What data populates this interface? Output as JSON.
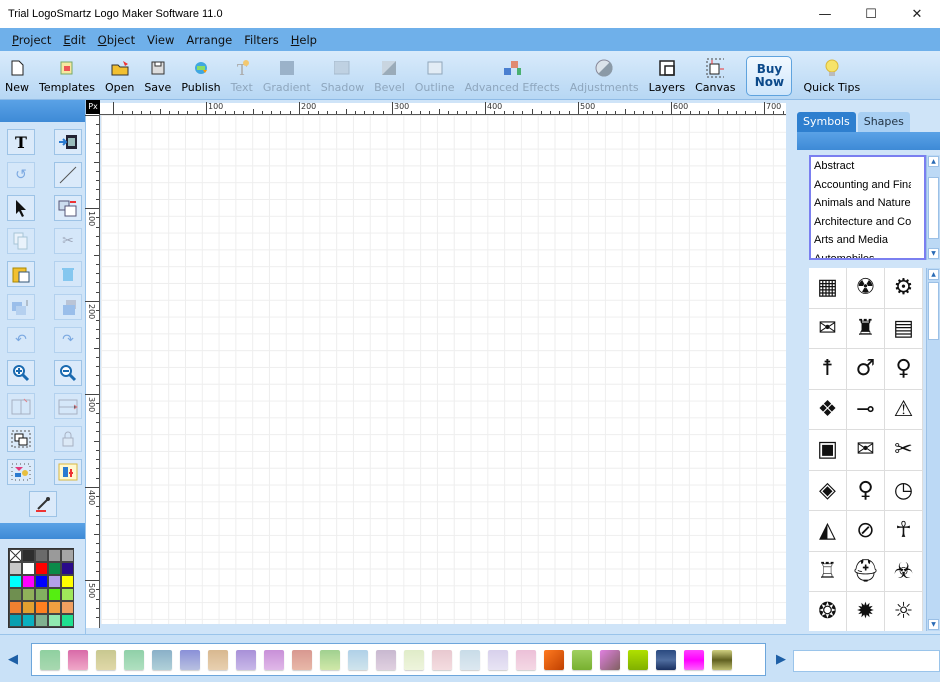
{
  "window": {
    "title": "Trial LogoSmartz Logo Maker Software 11.0",
    "minimize_glyph": "—",
    "maximize_glyph": "☐",
    "close_glyph": "✕"
  },
  "menu": [
    {
      "label": "Project",
      "underline": "P",
      "rest": "roject"
    },
    {
      "label": "Edit",
      "underline": "E",
      "rest": "dit"
    },
    {
      "label": "Object",
      "underline": "O",
      "rest": "bject"
    },
    {
      "label": "View",
      "underline": "",
      "rest": "View"
    },
    {
      "label": "Arrange",
      "underline": "",
      "rest": "Arrange"
    },
    {
      "label": "Filters",
      "underline": "",
      "rest": "Filters"
    },
    {
      "label": "Help",
      "underline": "H",
      "rest": "elp"
    }
  ],
  "toolbar": {
    "items": [
      {
        "label": "New",
        "icon": "new-icon",
        "enabled": true
      },
      {
        "label": "Templates",
        "icon": "templates-icon",
        "enabled": true
      },
      {
        "label": "Open",
        "icon": "open-icon",
        "enabled": true
      },
      {
        "label": "Save",
        "icon": "save-icon",
        "enabled": true
      },
      {
        "label": "Publish",
        "icon": "publish-icon",
        "enabled": true
      },
      {
        "label": "Text",
        "icon": "text-icon",
        "enabled": false
      },
      {
        "label": "Gradient",
        "icon": "gradient-icon",
        "enabled": false
      },
      {
        "label": "Shadow",
        "icon": "shadow-icon",
        "enabled": false
      },
      {
        "label": "Bevel",
        "icon": "bevel-icon",
        "enabled": false
      },
      {
        "label": "Outline",
        "icon": "outline-icon",
        "enabled": false
      },
      {
        "label": "Advanced Effects",
        "icon": "advanced-effects-icon",
        "enabled": false
      },
      {
        "label": "Adjustments",
        "icon": "adjustments-icon",
        "enabled": false
      },
      {
        "label": "Layers",
        "icon": "layers-icon",
        "enabled": true
      },
      {
        "label": "Canvas",
        "icon": "canvas-icon",
        "enabled": true
      }
    ],
    "buy_now": "Buy Now",
    "quick_tips": "Quick Tips"
  },
  "left_tools": [
    {
      "name": "text-tool",
      "enabled": true
    },
    {
      "name": "import-image-tool",
      "enabled": true
    },
    {
      "name": "rotate-tool",
      "enabled": false
    },
    {
      "name": "line-tool",
      "enabled": true
    },
    {
      "name": "select-tool",
      "enabled": true
    },
    {
      "name": "duplicate-tool",
      "enabled": true
    },
    {
      "name": "copy-tool",
      "enabled": false
    },
    {
      "name": "cut-tool",
      "enabled": false
    },
    {
      "name": "paste-tool",
      "enabled": true
    },
    {
      "name": "delete-tool",
      "enabled": false
    },
    {
      "name": "bring-forward-tool",
      "enabled": false
    },
    {
      "name": "send-backward-tool",
      "enabled": false
    },
    {
      "name": "undo-tool",
      "enabled": false
    },
    {
      "name": "redo-tool",
      "enabled": false
    },
    {
      "name": "zoom-in-tool",
      "enabled": true
    },
    {
      "name": "zoom-out-tool",
      "enabled": true
    },
    {
      "name": "flip-horizontal-tool",
      "enabled": false
    },
    {
      "name": "flip-vertical-tool",
      "enabled": false
    },
    {
      "name": "group-tool",
      "enabled": true
    },
    {
      "name": "lock-tool",
      "enabled": false
    },
    {
      "name": "align-tool",
      "enabled": true
    },
    {
      "name": "arrange-tool",
      "enabled": true
    }
  ],
  "palette_colors": [
    "none",
    "#2e2e2e",
    "#6a6a6a",
    "#9a9a9a",
    "#a6a6a6",
    "#c8c8c8",
    "#ffffff",
    "#ff0000",
    "#0b8a4a",
    "#2a0a8a",
    "#00ffff",
    "#ff00ff",
    "#0000ff",
    "#b4a0ea",
    "#ffff00",
    "#6f8f50",
    "#8fb05a",
    "#82b060",
    "#55ee11",
    "#9fe85a",
    "#f08030",
    "#e2a030",
    "#ff8020",
    "#f0a040",
    "#f0a060",
    "#0aa0b0",
    "#0ab0c0",
    "#80b090",
    "#90e8b0",
    "#20e090"
  ],
  "ruler": {
    "unit": "Px",
    "top_labels": [
      "100",
      "200",
      "300",
      "400",
      "500",
      "600",
      "700"
    ],
    "left_labels": [
      "100",
      "200",
      "300",
      "400",
      "500"
    ]
  },
  "right_panel": {
    "tabs": [
      {
        "label": "Symbols",
        "active": true
      },
      {
        "label": "Shapes",
        "active": false
      }
    ],
    "categories": [
      "Abstract",
      "Accounting and Finance",
      "Animals and Nature",
      "Architecture and Construction",
      "Arts and Media",
      "Automobiles"
    ],
    "symbols": [
      {
        "name": "checker-symbol",
        "glyph": "▦"
      },
      {
        "name": "radiation-symbol",
        "glyph": "☢"
      },
      {
        "name": "gear-symbol",
        "glyph": "⚙"
      },
      {
        "name": "money-symbol",
        "glyph": "✉"
      },
      {
        "name": "factory-symbol",
        "glyph": "♜"
      },
      {
        "name": "jar-symbol",
        "glyph": "▤"
      },
      {
        "name": "vitruvian-man-symbol",
        "glyph": "☨"
      },
      {
        "name": "male-symbol",
        "glyph": "♂"
      },
      {
        "name": "female-symbol",
        "glyph": "♀"
      },
      {
        "name": "cash-symbol",
        "glyph": "❖"
      },
      {
        "name": "fuse-symbol",
        "glyph": "⊸"
      },
      {
        "name": "warning-sign-symbol",
        "glyph": "⚠"
      },
      {
        "name": "framed-picture-symbol",
        "glyph": "▣"
      },
      {
        "name": "post-horn-mail-symbol",
        "glyph": "✉"
      },
      {
        "name": "comb-scissors-symbol",
        "glyph": "✂"
      },
      {
        "name": "tickets-symbol",
        "glyph": "◈"
      },
      {
        "name": "woman-symbol",
        "glyph": "♀"
      },
      {
        "name": "clock-symbol",
        "glyph": "◷"
      },
      {
        "name": "landscape-picture-symbol",
        "glyph": "◭"
      },
      {
        "name": "no-city-symbol",
        "glyph": "⊘"
      },
      {
        "name": "person-symbol",
        "glyph": "☥"
      },
      {
        "name": "desk-symbol",
        "glyph": "♖"
      },
      {
        "name": "helmet-symbol",
        "glyph": "⛑"
      },
      {
        "name": "biohazard-symbol",
        "glyph": "☣"
      },
      {
        "name": "dotted-circle-symbol",
        "glyph": "❂"
      },
      {
        "name": "sunburst-symbol",
        "glyph": "✹"
      },
      {
        "name": "sun-outline-symbol",
        "glyph": "☼"
      }
    ]
  },
  "swatches": [
    "linear-gradient(#8fd0a0,#a8d8b0)",
    "linear-gradient(#d86aa8,#f0a8c8)",
    "linear-gradient(#c8c890,#e0d8a8)",
    "linear-gradient(#90d0a8,#b0e0c0)",
    "linear-gradient(#8ab0c8,#b0d0d8)",
    "linear-gradient(#8a90d8,#b8c0e0)",
    "linear-gradient(#d8b890,#e8d0b0)",
    "linear-gradient(#a890d8,#c8b8e8)",
    "linear-gradient(#c890d8,#e0b8e8)",
    "linear-gradient(#d89890,#e8b8a8)",
    "linear-gradient(#a0d090,#d0e8a8)",
    "linear-gradient(#b0d0e8,#d0e4ec)",
    "linear-gradient(#c8b8d0,#e0d0e0)",
    "linear-gradient(#e0ecc8,#eef4dc)",
    "linear-gradient(#e8c8d0,#f4dce0)",
    "linear-gradient(#c8dce8,#dce8f0)",
    "linear-gradient(#d8d0ec,#e8e4f4)",
    "linear-gradient(#ecc0d8,#f4d8e4)",
    "linear-gradient(135deg,#ff7a20,#c04000)",
    "linear-gradient(#a0d060,#78b030)",
    "linear-gradient(135deg,#e080e0,#806060)",
    "linear-gradient(#b0e000,#80b000)",
    "linear-gradient(#2a4a80,#506ea0 50%,#1a3060)",
    "linear-gradient(#ff40ff,#ff00ff 50%,#ff60ff)",
    "linear-gradient(#d0d080,#606020 50%,#c0c070)"
  ]
}
